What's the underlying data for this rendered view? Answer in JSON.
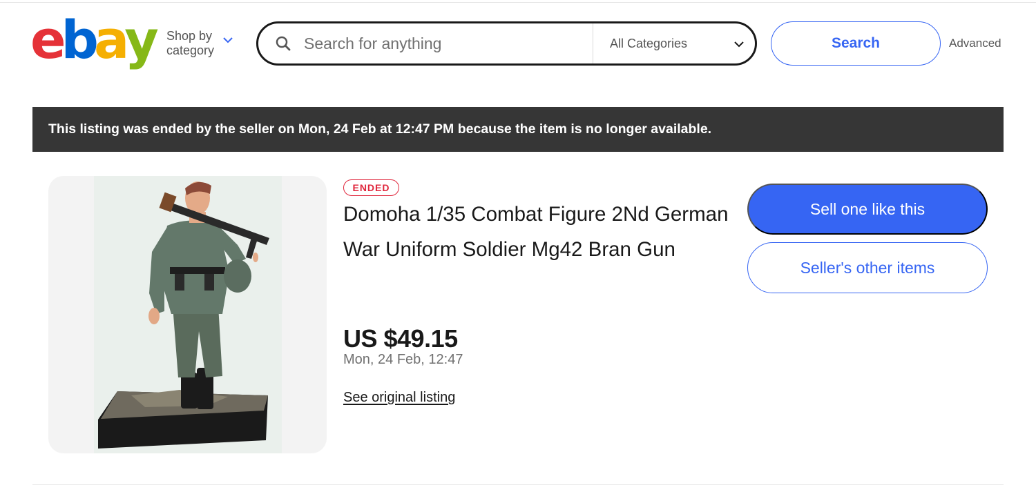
{
  "header": {
    "logo": {
      "letters": [
        "e",
        "b",
        "a",
        "y"
      ],
      "colors": [
        "#e53238",
        "#0064d2",
        "#f5af02",
        "#86b817"
      ]
    },
    "shop_by_line1": "Shop by",
    "shop_by_line2": "category",
    "search_placeholder": "Search for anything",
    "category_selected": "All Categories",
    "search_button": "Search",
    "advanced_link": "Advanced"
  },
  "banner": {
    "message": "This listing was ended by the seller on Mon, 24 Feb at 12:47 PM because the item is no longer available."
  },
  "listing": {
    "status_badge": "ENDED",
    "title": "Domoha 1/35 Combat Figure 2Nd German War Uniform Soldier Mg42 Bran Gun",
    "price": "US $49.15",
    "ended_date": "Mon, 24 Feb, 12:47",
    "original_listing_link": "See original listing",
    "image_icon": "product-photo-soldier-figure"
  },
  "actions": {
    "sell_one_like_this": "Sell one like this",
    "sellers_other_items": "Seller's other items"
  },
  "colors": {
    "accent_blue": "#3665f3",
    "banner_bg": "#363636",
    "ended_red": "#e0263c"
  }
}
